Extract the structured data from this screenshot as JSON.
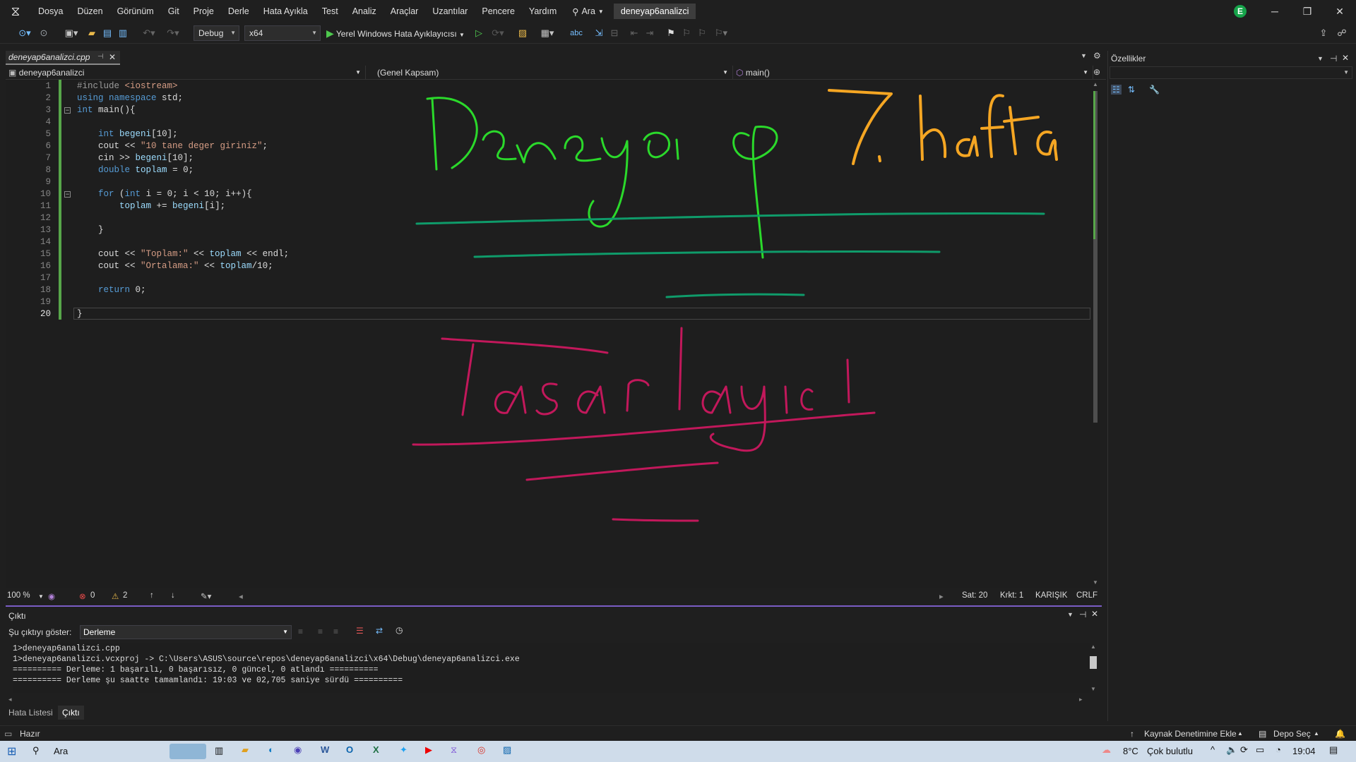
{
  "menu": {
    "items": [
      "Dosya",
      "Düzen",
      "Görünüm",
      "Git",
      "Proje",
      "Derle",
      "Hata Ayıkla",
      "Test",
      "Analiz",
      "Araçlar",
      "Uzantılar",
      "Pencere",
      "Yardım"
    ],
    "search_label": "Ara",
    "solution_name": "deneyap6analizci",
    "avatar_letter": "E"
  },
  "toolbar": {
    "config": "Debug",
    "platform": "x64",
    "run_label": "Yerel Windows Hata Ayıklayıcısı"
  },
  "editor": {
    "tab_label": "deneyap6analizci.cpp",
    "nav_project": "deneyap6analizci",
    "nav_scope": "(Genel Kapsam)",
    "nav_member": "main()",
    "line_numbers": [
      "1",
      "2",
      "3",
      "4",
      "5",
      "6",
      "7",
      "8",
      "9",
      "10",
      "11",
      "12",
      "13",
      "14",
      "15",
      "16",
      "17",
      "18",
      "19",
      "20"
    ],
    "code_lines": [
      "#include <iostream>",
      "using namespace std;",
      "int main(){",
      "",
      "    int begeni[10];",
      "    cout << \"10 tane deger giriniz\";",
      "    cin >> begeni[10];",
      "    double toplam = 0;",
      "",
      "    for (int i = 0; i < 10; i++){",
      "        toplam += begeni[i];",
      "",
      "    }",
      "",
      "    cout << \"Toplam:\" << toplam << endl;",
      "    cout << \"Ortalama:\" << toplam/10;",
      "",
      "    return 0;",
      "",
      "}"
    ]
  },
  "editor_status": {
    "zoom": "100 %",
    "errors": "0",
    "warnings": "2",
    "line": "Sat: 20",
    "col": "Krkt: 1",
    "mode": "KARIŞIK",
    "eol": "CRLF"
  },
  "output": {
    "title": "Çıktı",
    "show_label": "Şu çıktıyı göster:",
    "source": "Derleme",
    "lines": [
      "1>deneyap6analizci.cpp",
      "1>deneyap6analizci.vcxproj -> C:\\Users\\ASUS\\source\\repos\\deneyap6analizci\\x64\\Debug\\deneyap6analizci.exe",
      "========== Derleme: 1 başarılı, 0 başarısız, 0 güncel, 0 atlandı ==========",
      "========== Derleme şu saatte tamamlandı: 19:03 ve 02,705 saniye sürdü =========="
    ]
  },
  "bottom_tabs": [
    "Hata Listesi",
    "Çıktı"
  ],
  "properties": {
    "title": "Özellikler"
  },
  "statusbar": {
    "ready": "Hazır",
    "source_control": "Kaynak Denetimine Ekle",
    "repo": "Depo Seç"
  },
  "taskbar": {
    "search": "Ara",
    "weather_temp": "8°C",
    "weather_text": "Çok bulutlu",
    "time": "19:04"
  },
  "ink": {
    "title": "Deneyap",
    "week": "7. hafta",
    "subtitle": "Tasarlayıcı",
    "colors": {
      "green": "#2bd92b",
      "orange": "#f5a623",
      "teal": "#0f9b6a",
      "magenta": "#c2185b"
    }
  }
}
